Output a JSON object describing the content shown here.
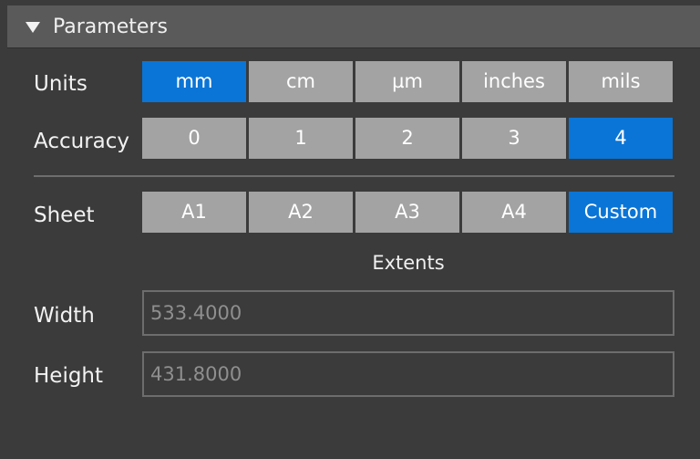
{
  "header": {
    "title": "Parameters",
    "expanded_icon": "triangle-down-icon"
  },
  "units": {
    "label": "Units",
    "options": [
      "mm",
      "cm",
      "µm",
      "inches",
      "mils"
    ],
    "selected": "mm"
  },
  "accuracy": {
    "label": "Accuracy",
    "options": [
      "0",
      "1",
      "2",
      "3",
      "4"
    ],
    "selected": "4"
  },
  "sheet": {
    "label": "Sheet",
    "options": [
      "A1",
      "A2",
      "A3",
      "A4",
      "Custom"
    ],
    "selected": "Custom"
  },
  "extents": {
    "title": "Extents",
    "width": {
      "label": "Width",
      "value": "533.4000"
    },
    "height": {
      "label": "Height",
      "value": "431.8000"
    }
  },
  "colors": {
    "panel_bg": "#3b3b3b",
    "header_bg": "#5a5a5a",
    "button_bg": "#a3a3a3",
    "selected_bg": "#0a75d6"
  }
}
